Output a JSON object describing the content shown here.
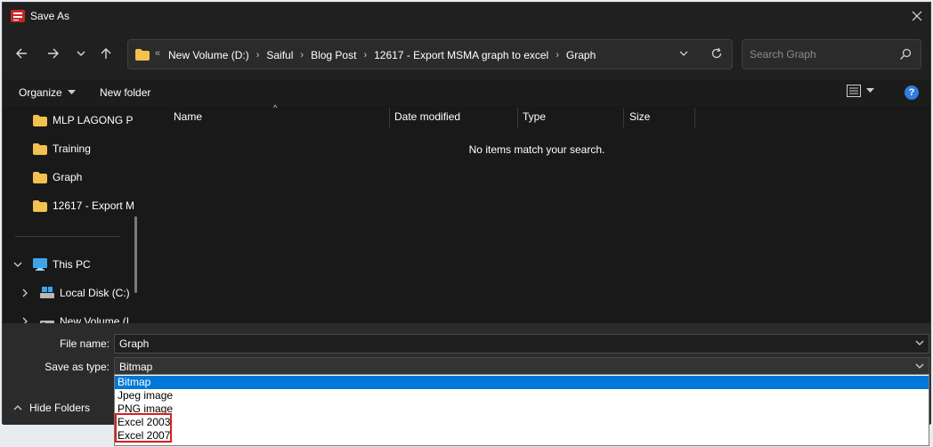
{
  "window": {
    "title": "Save As"
  },
  "address": {
    "overflow": "«",
    "crumbs": [
      "New Volume (D:)",
      "Saiful",
      "Blog Post",
      "12617 - Export MSMA graph to excel",
      "Graph"
    ]
  },
  "search": {
    "placeholder": "Search Graph"
  },
  "commandbar": {
    "organize": "Organize",
    "new_folder": "New folder",
    "help": "?"
  },
  "sidebar": {
    "items": [
      "MLP LAGONG P",
      "Training",
      "Graph",
      "12617 - Export M",
      "This PC",
      "Local Disk (C:)",
      "New Volume (I"
    ]
  },
  "filelist": {
    "columns": [
      "Name",
      "Date modified",
      "Type",
      "Size"
    ],
    "empty_message": "No items match your search."
  },
  "form": {
    "file_name_label": "File name:",
    "file_name_value": "Graph",
    "save_type_label": "Save as type:",
    "save_type_value": "Bitmap",
    "type_options": [
      "Bitmap",
      "Jpeg image",
      "PNG image",
      "Excel 2003",
      "Excel 2007"
    ],
    "hide_folders": "Hide Folders"
  },
  "colors": {
    "accent": "#0078d7",
    "highlight_box": "#d81e1e",
    "folder": "#f2c14e"
  }
}
